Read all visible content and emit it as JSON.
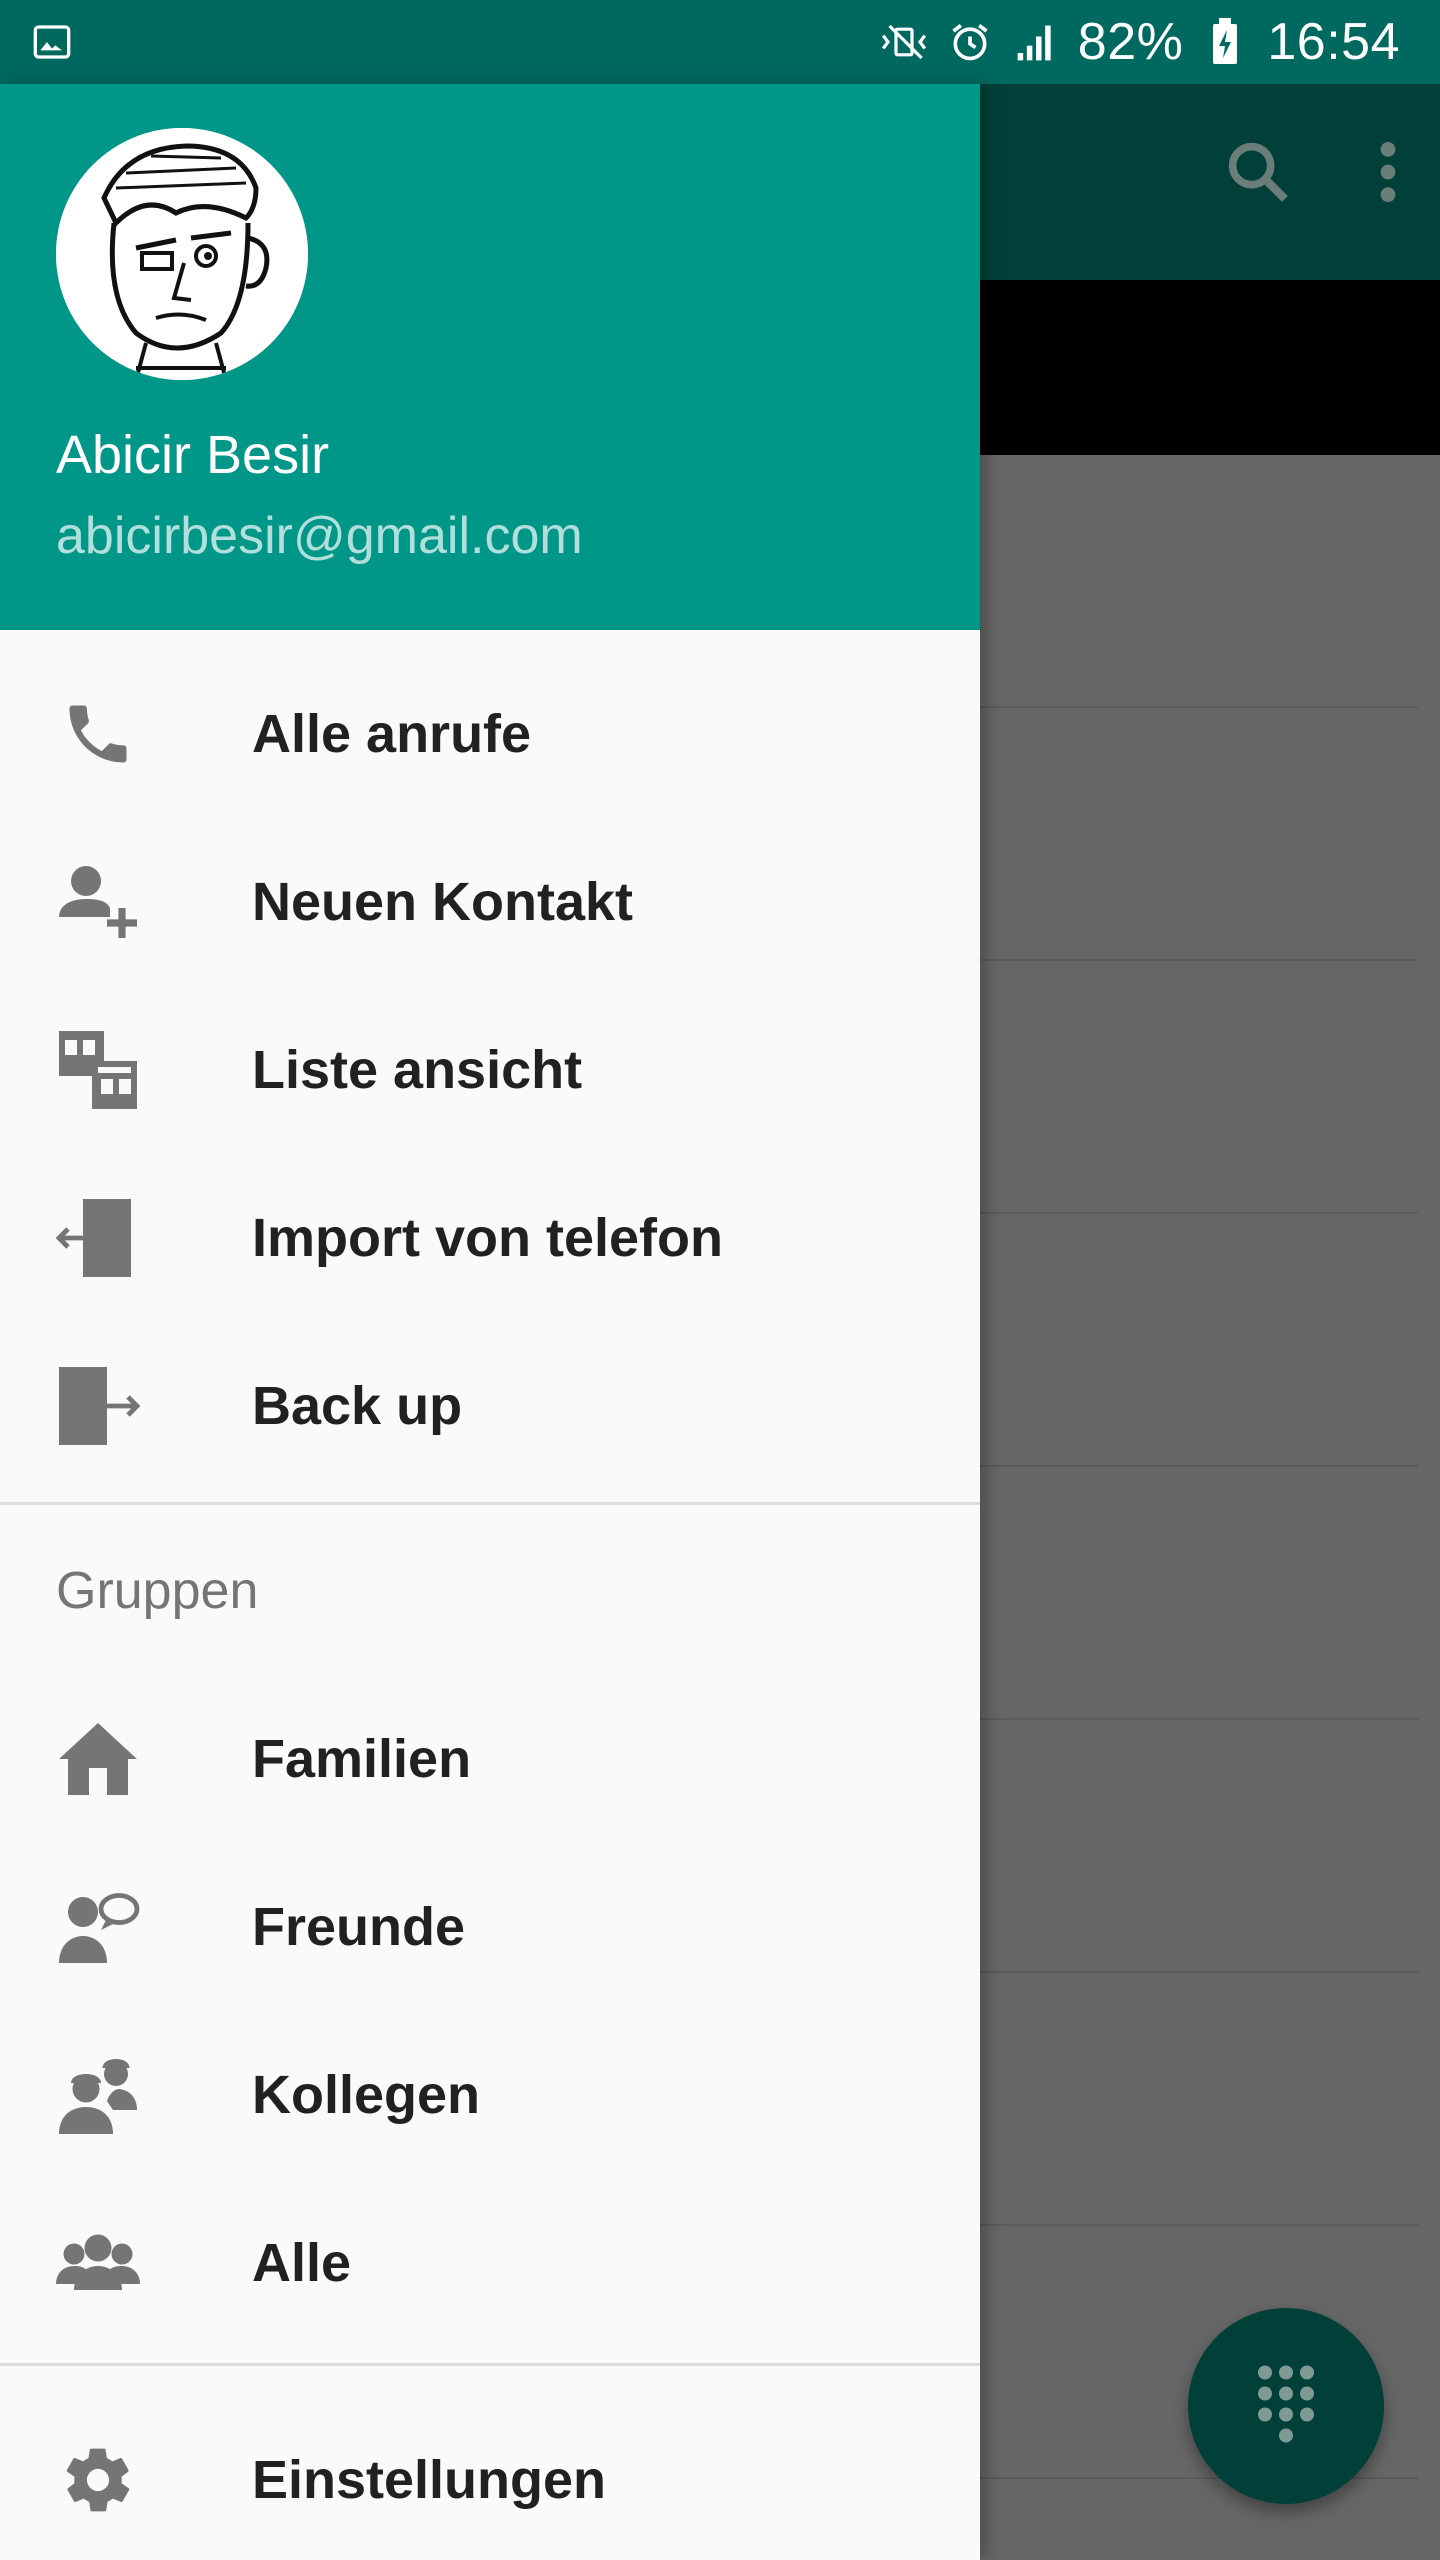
{
  "status_bar": {
    "battery": "82%",
    "time": "16:54",
    "icons": [
      "image-icon",
      "vibrate-mute-icon",
      "alarm-icon",
      "signal-icon",
      "battery-charging-icon"
    ]
  },
  "app_toolbar": {
    "icons": [
      "search-icon",
      "more-vert-icon"
    ]
  },
  "drawer": {
    "header": {
      "name": "Abicir Besir",
      "email": "abicirbesir@gmail.com",
      "header_color": "#009688"
    },
    "main_items": [
      {
        "label": "Alle anrufe",
        "icon": "phone-icon"
      },
      {
        "label": "Neuen Kontakt",
        "icon": "add-person-icon"
      },
      {
        "label": "Liste ansicht",
        "icon": "list-view-icon"
      },
      {
        "label": "Import von telefon",
        "icon": "import-icon"
      },
      {
        "label": "Back up",
        "icon": "export-icon"
      }
    ],
    "groups_header": "Gruppen",
    "group_items": [
      {
        "label": "Familien",
        "icon": "home-icon"
      },
      {
        "label": "Freunde",
        "icon": "friends-icon"
      },
      {
        "label": "Kollegen",
        "icon": "colleagues-icon"
      },
      {
        "label": "Alle",
        "icon": "group-all-icon"
      }
    ],
    "settings_label": "Einstellungen"
  },
  "fab": {
    "icon": "dialpad-icon",
    "color": "#014038"
  }
}
